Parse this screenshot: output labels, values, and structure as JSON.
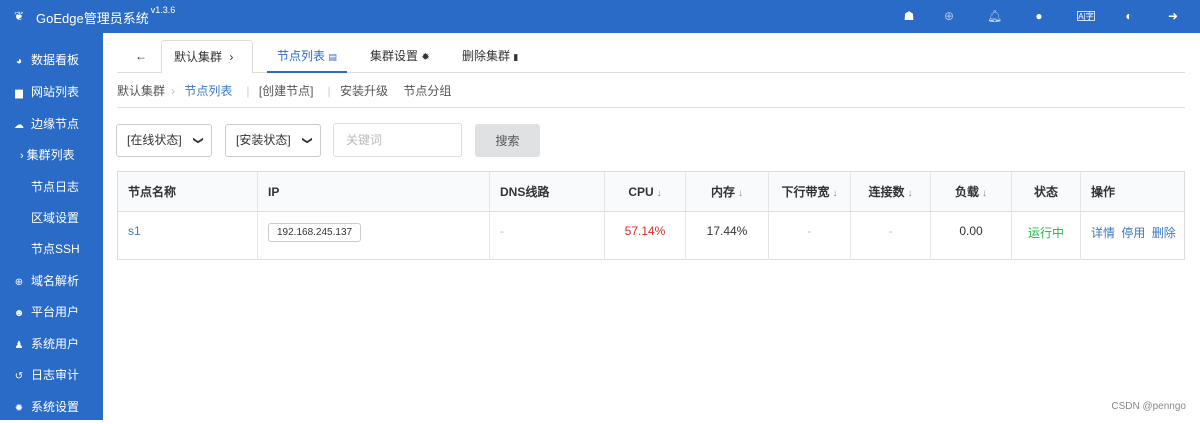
{
  "header": {
    "title": "GoEdge管理员系统",
    "version": "v1.3.6",
    "logo_icon": "leaf-icon",
    "icons": [
      "ticket-icon",
      "globe-icon",
      "bell-icon",
      "user-icon",
      "translate-icon",
      "contrast-icon",
      "logout-icon"
    ]
  },
  "sidebar": {
    "items": [
      {
        "label": "数据看板",
        "icon": "dashboard-icon"
      },
      {
        "label": "网站列表",
        "icon": "clone-icon"
      },
      {
        "label": "边缘节点",
        "icon": "cloud-icon"
      },
      {
        "label": "集群列表",
        "icon": "chevron-right-icon",
        "sub": true
      },
      {
        "label": "节点日志",
        "sub": true
      },
      {
        "label": "区域设置",
        "sub": true
      },
      {
        "label": "节点SSH",
        "sub": true
      },
      {
        "label": "域名解析",
        "icon": "globe-icon"
      },
      {
        "label": "平台用户",
        "icon": "users-icon"
      },
      {
        "label": "系统用户",
        "icon": "user-secret-icon"
      },
      {
        "label": "日志审计",
        "icon": "history-icon"
      },
      {
        "label": "系统设置",
        "icon": "gear-icon"
      }
    ]
  },
  "tabs": {
    "back": "←",
    "cluster": "默认集群",
    "cluster_arrow": "›",
    "nodes": "节点列表",
    "settings": "集群设置",
    "delete": "删除集群"
  },
  "breadcrumb": {
    "cluster": "默认集群",
    "separator": "›",
    "current": "节点列表",
    "create": "[创建节点]",
    "upgrade": "安装升级",
    "groups": "节点分组"
  },
  "filters": {
    "online_status": "[在线状态]",
    "install_status": "[安装状态]",
    "keyword_placeholder": "关键词",
    "search": "搜索"
  },
  "table": {
    "headers": [
      "节点名称",
      "IP",
      "DNS线路",
      "CPU",
      "内存",
      "下行带宽",
      "连接数",
      "负载",
      "状态",
      "操作"
    ],
    "rows": [
      {
        "name": "s1",
        "ip": "192.168.245.137",
        "dns": "-",
        "cpu": "57.14%",
        "memory": "17.44%",
        "bandwidth": "-",
        "connections": "-",
        "load": "0.00",
        "status": "运行中",
        "actions": [
          "详情",
          "停用",
          "删除"
        ]
      }
    ]
  },
  "colors": {
    "brand": "#2a6bc7",
    "cpu_warning": "#db2828",
    "status_ok": "#21ba45",
    "link": "#3b79c6"
  },
  "footer": "CSDN @penngo"
}
